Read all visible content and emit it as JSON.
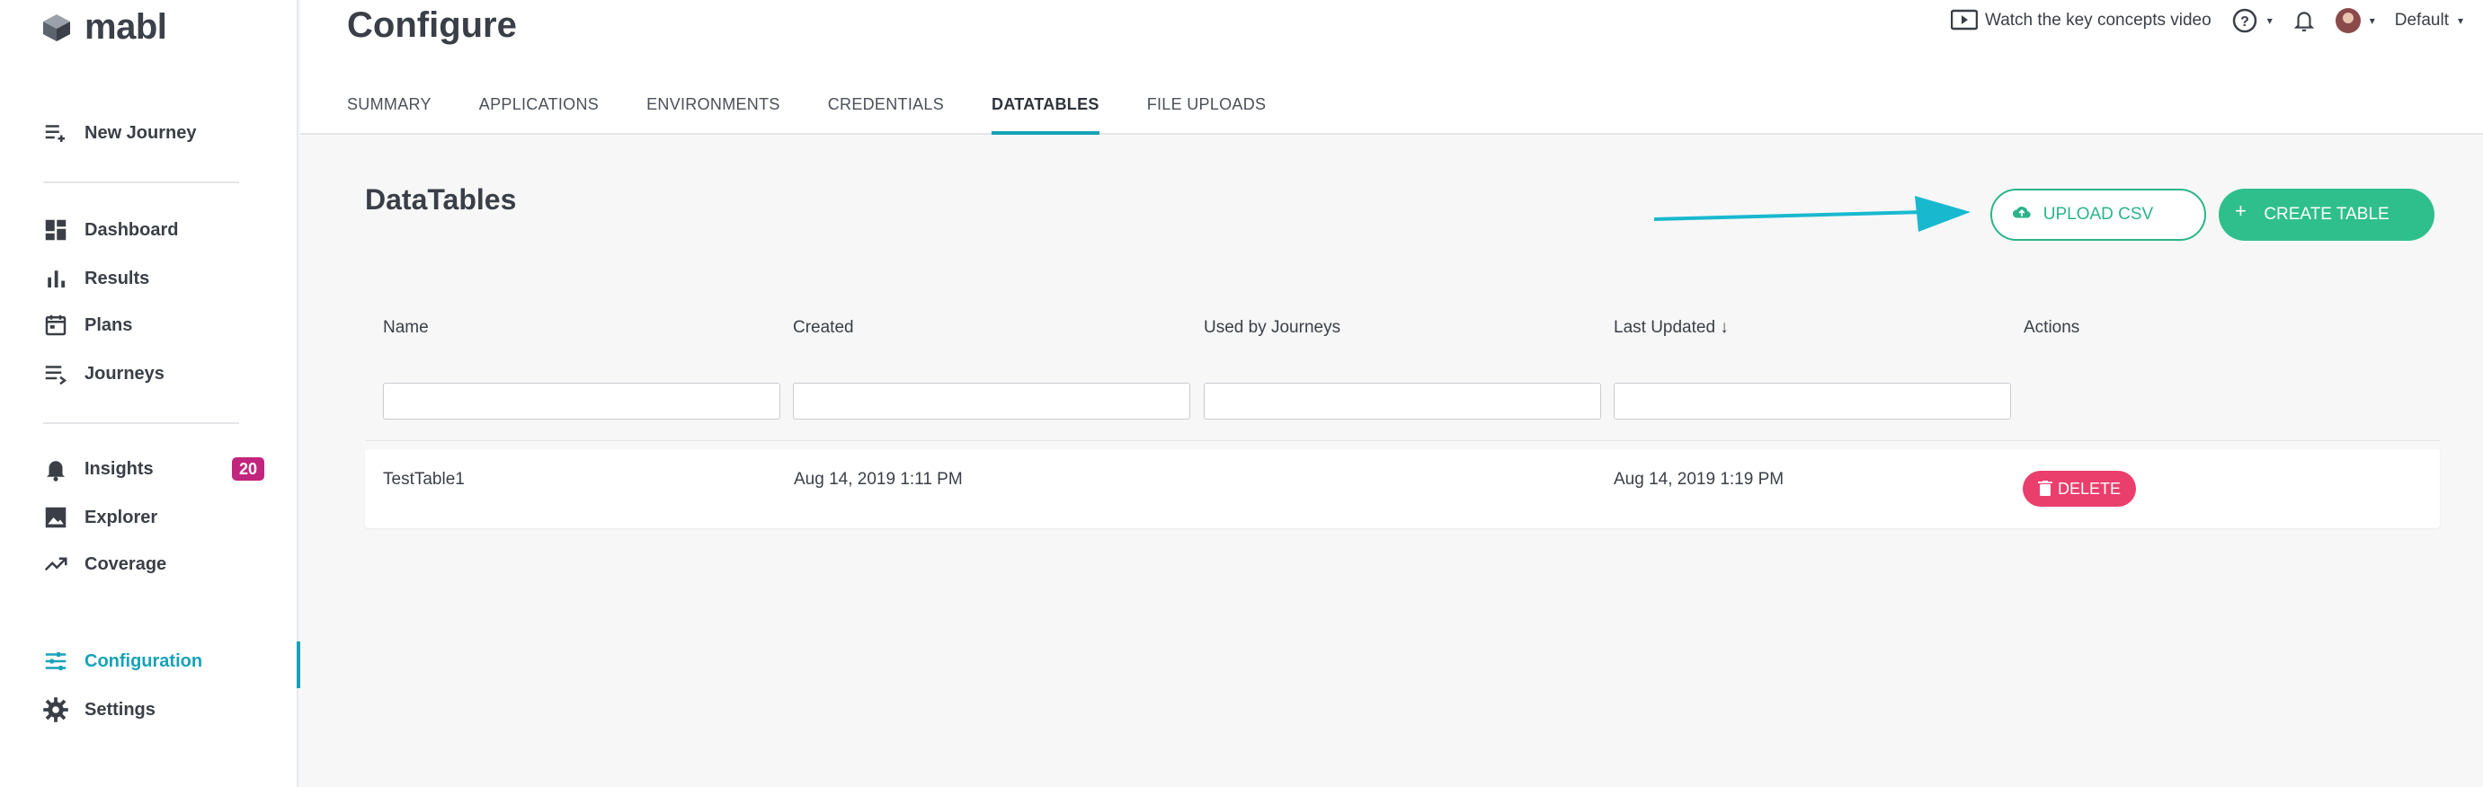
{
  "app": {
    "logo_text": "mabl"
  },
  "sidebar": {
    "items": [
      {
        "label": "New Journey",
        "icon": "add-list-icon"
      },
      {
        "label": "Dashboard",
        "icon": "dashboard-icon"
      },
      {
        "label": "Results",
        "icon": "bar-chart-icon"
      },
      {
        "label": "Plans",
        "icon": "calendar-icon"
      },
      {
        "label": "Journeys",
        "icon": "list-icon"
      },
      {
        "label": "Insights",
        "icon": "bell-icon",
        "badge": "20"
      },
      {
        "label": "Explorer",
        "icon": "image-icon"
      },
      {
        "label": "Coverage",
        "icon": "trend-icon"
      },
      {
        "label": "Configuration",
        "icon": "sliders-icon",
        "active": true
      },
      {
        "label": "Settings",
        "icon": "gear-icon"
      }
    ]
  },
  "header": {
    "title": "Configure",
    "tabs": [
      {
        "label": "SUMMARY"
      },
      {
        "label": "APPLICATIONS"
      },
      {
        "label": "ENVIRONMENTS"
      },
      {
        "label": "CREDENTIALS"
      },
      {
        "label": "DATATABLES",
        "active": true
      },
      {
        "label": "FILE UPLOADS"
      }
    ],
    "video_link": "Watch the key concepts video",
    "workspace": "Default"
  },
  "main": {
    "title": "DataTables",
    "upload_label": "UPLOAD CSV",
    "create_label": "CREATE TABLE",
    "columns": [
      "Name",
      "Created",
      "Used by Journeys",
      "Last Updated ↓",
      "Actions"
    ],
    "rows": [
      {
        "name": "TestTable1",
        "created": "Aug 14, 2019 1:11 PM",
        "used_by": "",
        "last_updated": "Aug 14, 2019 1:19 PM",
        "action": "DELETE"
      }
    ]
  },
  "colors": {
    "accent": "#17a2b8",
    "primary_green": "#2fbf8c",
    "danger": "#ea3e6c",
    "badge": "#c2257d"
  }
}
